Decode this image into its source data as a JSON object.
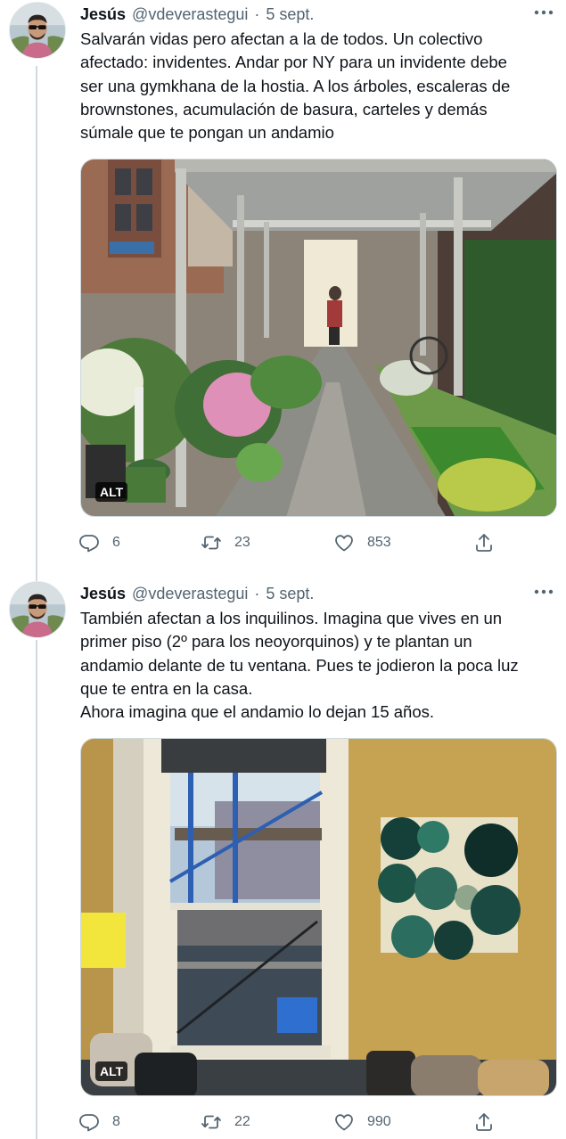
{
  "tweets": [
    {
      "author": {
        "name": "Jesús",
        "handle": "@vdeverastegui",
        "separator": "·",
        "date": "5 sept."
      },
      "text": "Salvarán vidas pero afectan a la de todos. Un colectivo\nafectado: invidentes. Andar por NY para un invidente debe\nser una gymkhana de la hostia. A los árboles, escaleras de\nbrownstones, acumulación de basura, carteles y demás\nsúmale que te pongan un andamio",
      "media": {
        "alt_label": "ALT"
      },
      "stats": {
        "replies": "6",
        "retweets": "23",
        "likes": "853"
      },
      "icons": {
        "more": "more-icon",
        "reply": "reply-icon",
        "retweet": "retweet-icon",
        "like": "like-icon",
        "share": "share-icon"
      }
    },
    {
      "author": {
        "name": "Jesús",
        "handle": "@vdeverastegui",
        "separator": "·",
        "date": "5 sept."
      },
      "text": "También afectan a los inquilinos. Imagina que vives en un\nprimer piso (2º para los neoyorquinos) y te plantan un\nandamio delante de tu ventana. Pues te jodieron la poca luz\nque te entra en la casa.\nAhora imagina que el andamio lo dejan 15 años.",
      "media": {
        "alt_label": "ALT"
      },
      "stats": {
        "replies": "8",
        "retweets": "22",
        "likes": "990"
      },
      "icons": {
        "more": "more-icon",
        "reply": "reply-icon",
        "retweet": "retweet-icon",
        "like": "like-icon",
        "share": "share-icon"
      }
    }
  ],
  "colors": {
    "text_primary": "#0f1419",
    "text_secondary": "#536471",
    "thread_line": "#cfd9de",
    "background": "#ffffff"
  }
}
